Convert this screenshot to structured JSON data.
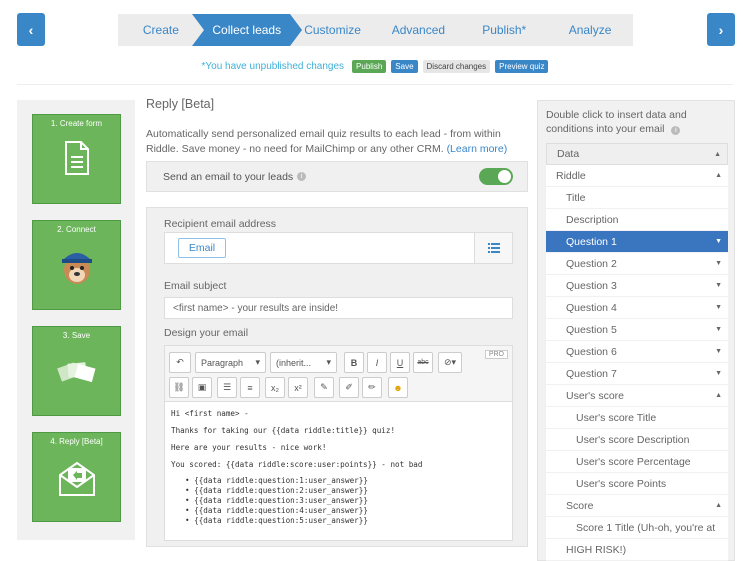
{
  "nav": {
    "prev_icon": "chevron-left-icon",
    "next_icon": "chevron-right-icon",
    "prev_label": "‹",
    "next_label": "›",
    "steps": [
      "Create",
      "Collect leads",
      "Customize",
      "Advanced",
      "Publish*",
      "Analyze"
    ],
    "active_step": "Collect leads"
  },
  "status": {
    "unpublished": "*You have unpublished changes",
    "publish": "Publish",
    "save": "Save",
    "discard": "Discard changes",
    "preview": "Preview quiz"
  },
  "left_tiles": [
    {
      "label": "1. Create form",
      "icon": "document-icon"
    },
    {
      "label": "2. Connect",
      "icon": "mailchimp-icon"
    },
    {
      "label": "3. Save",
      "icon": "stack-icon"
    },
    {
      "label": "4. Reply [Beta]",
      "icon": "envelope-reply-icon"
    }
  ],
  "main": {
    "title": "Reply [Beta]",
    "description": "Automatically send personalized email quiz results to each lead - from within Riddle. Save money - no need for MailChimp or any other CRM.",
    "learn_more": "(Learn more)",
    "send_toggle_label": "Send an email to your leads",
    "send_toggle_on": true,
    "recipient_label": "Recipient email address",
    "recipient_chip": "Email",
    "subject_label": "Email subject",
    "subject_value": "<first name> - your results are inside!",
    "design_label": "Design your email",
    "toolbar": {
      "paragraph": "Paragraph",
      "inherit": "(inherit...",
      "bold": "B",
      "italic": "I",
      "underline": "U",
      "strike": "abc",
      "sub": "x₂",
      "sup": "x²",
      "pro": "PRO"
    },
    "body_lines": [
      "Hi <first name> -",
      "Thanks for taking our {{data riddle:title}} quiz!",
      "Here are your results - nice work!",
      "You scored: {{data riddle:score:user:points}} - not bad"
    ],
    "bullets": [
      "{{data riddle:question:1:user_answer}}",
      "{{data riddle:question:2:user_answer}}",
      "{{data riddle:question:3:user_answer}}",
      "{{data riddle:question:4:user_answer}}",
      "{{data riddle:question:5:user_answer}}"
    ]
  },
  "right": {
    "title": "Double click to insert data and conditions into your email",
    "tree": [
      {
        "label": "Data",
        "level": "head",
        "caret": "▲"
      },
      {
        "label": "Riddle",
        "level": 0,
        "caret": "▲"
      },
      {
        "label": "Title",
        "level": 1,
        "caret": ""
      },
      {
        "label": "Description",
        "level": 1,
        "caret": ""
      },
      {
        "label": "Question 1",
        "level": 1,
        "caret": "▼",
        "selected": true
      },
      {
        "label": "Question 2",
        "level": 1,
        "caret": "▼"
      },
      {
        "label": "Question 3",
        "level": 1,
        "caret": "▼"
      },
      {
        "label": "Question 4",
        "level": 1,
        "caret": "▼"
      },
      {
        "label": "Question 5",
        "level": 1,
        "caret": "▼"
      },
      {
        "label": "Question 6",
        "level": 1,
        "caret": "▼"
      },
      {
        "label": "Question 7",
        "level": 1,
        "caret": "▼"
      },
      {
        "label": "User's score",
        "level": 1,
        "caret": "▲"
      },
      {
        "label": "User's score Title",
        "level": 2,
        "caret": ""
      },
      {
        "label": "User's score Description",
        "level": 2,
        "caret": ""
      },
      {
        "label": "User's score Percentage",
        "level": 2,
        "caret": ""
      },
      {
        "label": "User's score Points",
        "level": 2,
        "caret": ""
      },
      {
        "label": "Score",
        "level": 1,
        "caret": "▲"
      },
      {
        "label": "Score 1 Title (Uh-oh, you're at",
        "level": 2,
        "caret": ""
      },
      {
        "label": "HIGH RISK!)",
        "level": 1,
        "caret": ""
      }
    ]
  },
  "colors": {
    "accent": "#3a87c8",
    "green": "#6cb55b",
    "selected": "#3a76c0"
  }
}
